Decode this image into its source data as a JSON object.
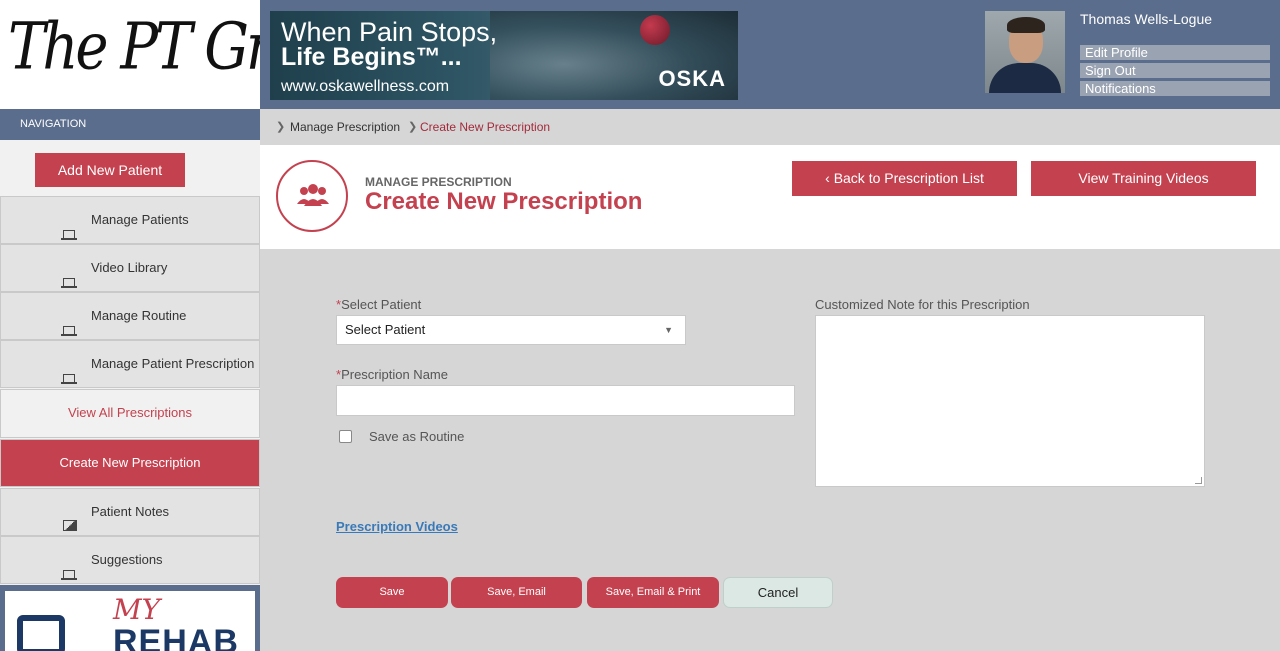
{
  "logo": {
    "text": "The PT Group"
  },
  "banner": {
    "line1": "When Pain Stops,",
    "line2": "Life Begins™...",
    "url": "www.oskawellness.com",
    "brand": "OSKA"
  },
  "user": {
    "name": "Thomas Wells-Logue",
    "links": [
      "Edit Profile",
      "Sign Out",
      "Notifications"
    ]
  },
  "navigation": {
    "heading": "NAVIGATION",
    "add_button": "Add New Patient",
    "items": [
      {
        "label": "Manage Patients",
        "icon": "laptop-icon"
      },
      {
        "label": "Video Library",
        "icon": "laptop-icon"
      },
      {
        "label": "Manage Routine",
        "icon": "laptop-icon"
      },
      {
        "label": "Manage Patient Prescription",
        "icon": "laptop-icon"
      },
      {
        "label": "View All Prescriptions",
        "state": "sub"
      },
      {
        "label": "Create New Prescription",
        "state": "active"
      },
      {
        "label": "Patient Notes",
        "icon": "image-icon"
      },
      {
        "label": "Suggestions",
        "icon": "laptop-icon"
      }
    ],
    "promo": {
      "line1": "MY",
      "line2": "REHAB"
    }
  },
  "breadcrumb": [
    "Manage Prescription",
    "Create New Prescription"
  ],
  "page": {
    "subtitle": "MANAGE PRESCRIPTION",
    "title": "Create New Prescription",
    "back_button": "Back to Prescription List",
    "videos_button": "View Training Videos"
  },
  "form": {
    "required_mark": "*",
    "patient_label": "Select Patient",
    "patient_value": "Select Patient",
    "name_label": "Prescription Name",
    "name_value": "",
    "routine_label": "Save as Routine",
    "note_label": "Customized Note for this Prescription",
    "videos_link": "Prescription Videos",
    "buttons": {
      "save": "Save",
      "save_email": "Save, Email",
      "save_email_print": "Save, Email & Print",
      "cancel": "Cancel"
    }
  },
  "colors": {
    "accent": "#c4424f",
    "header": "#5b6d8c",
    "link": "#3a79b8"
  }
}
